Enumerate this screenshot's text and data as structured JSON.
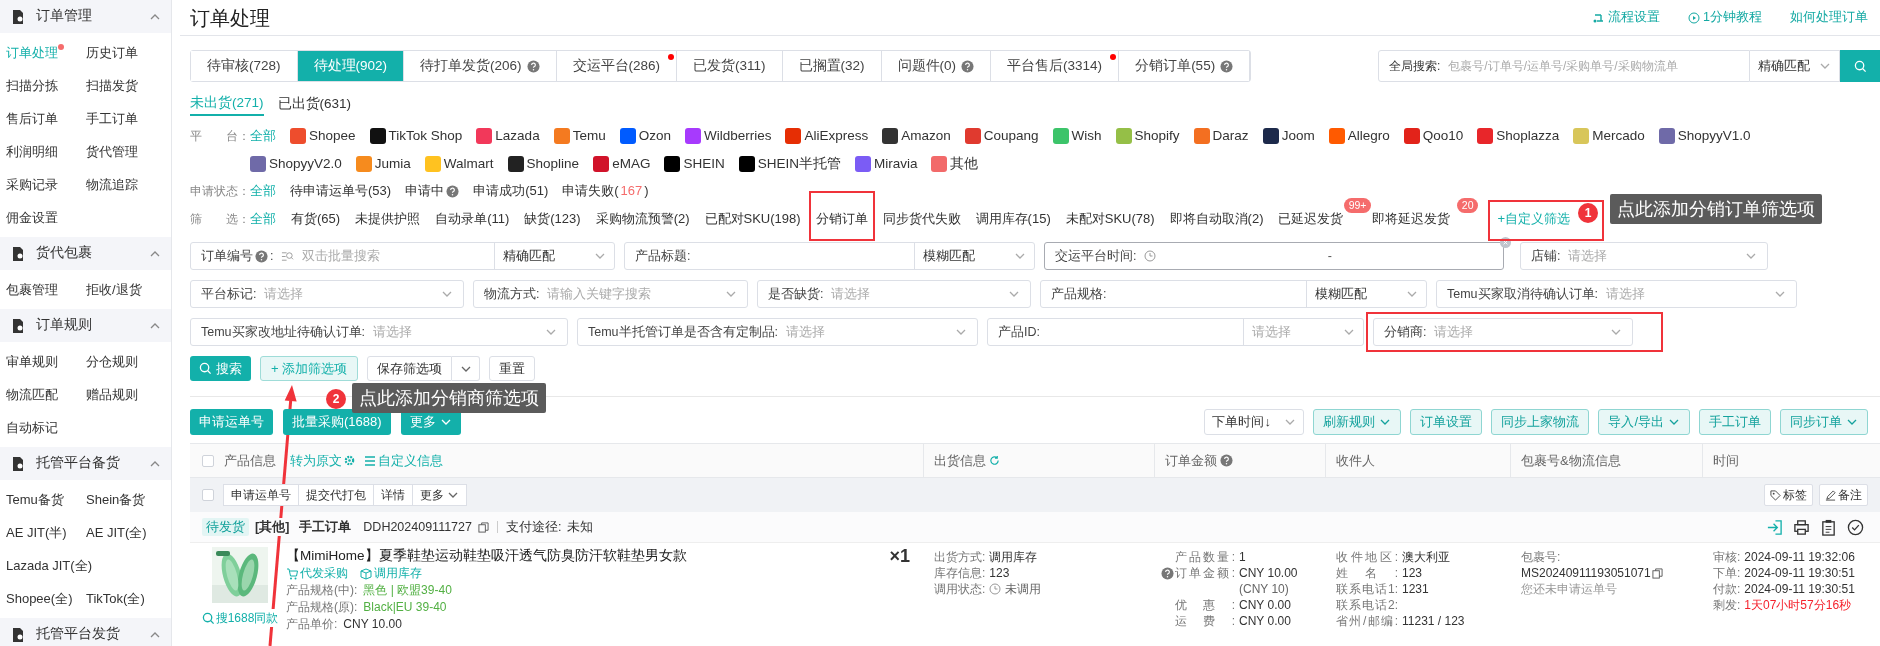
{
  "sidebar": {
    "sections": [
      {
        "title": "订单管理",
        "expanded": true,
        "items": [
          {
            "label": "订单处理",
            "selected": true,
            "dot": true
          },
          {
            "label": "历史订单",
            "selected": false,
            "dot": false
          },
          {
            "label": "扫描分拣",
            "selected": false,
            "dot": false
          },
          {
            "label": "扫描发货",
            "selected": false,
            "dot": false
          },
          {
            "label": "售后订单",
            "selected": false,
            "dot": false
          },
          {
            "label": "手工订单",
            "selected": false,
            "dot": false
          },
          {
            "label": "利润明细",
            "selected": false,
            "dot": false
          },
          {
            "label": "货代管理",
            "selected": false,
            "dot": false
          },
          {
            "label": "采购记录",
            "selected": false,
            "dot": false
          },
          {
            "label": "物流追踪",
            "selected": false,
            "dot": false
          },
          {
            "label": "佣金设置",
            "selected": false,
            "dot": false
          }
        ]
      },
      {
        "title": "货代包裹",
        "expanded": true,
        "items": [
          {
            "label": "包裹管理",
            "selected": false,
            "dot": false
          },
          {
            "label": "拒收/退货",
            "selected": false,
            "dot": false
          }
        ]
      },
      {
        "title": "订单规则",
        "expanded": true,
        "items": [
          {
            "label": "审单规则",
            "selected": false,
            "dot": false
          },
          {
            "label": "分仓规则",
            "selected": false,
            "dot": false
          },
          {
            "label": "物流匹配",
            "selected": false,
            "dot": false
          },
          {
            "label": "赠品规则",
            "selected": false,
            "dot": false
          },
          {
            "label": "自动标记",
            "selected": false,
            "dot": false
          }
        ]
      },
      {
        "title": "托管平台备货",
        "expanded": true,
        "items": [
          {
            "label": "Temu备货",
            "selected": false,
            "dot": false
          },
          {
            "label": "Shein备货",
            "selected": false,
            "dot": false
          },
          {
            "label": "AE JIT(半)",
            "selected": false,
            "dot": false
          },
          {
            "label": "AE JIT(全)",
            "selected": false,
            "dot": false
          },
          {
            "label": "Lazada JIT(全)",
            "selected": false,
            "dot": false
          },
          {
            "label": "Shopee(全)",
            "selected": false,
            "dot": false
          },
          {
            "label": "TikTok(全)",
            "selected": false,
            "dot": false
          }
        ]
      },
      {
        "title": "托管平台发货",
        "expanded": true
      }
    ]
  },
  "page_title": "订单处理",
  "header_links": [
    {
      "label": "流程设置",
      "kind": "flow"
    },
    {
      "label": "1分钟教程",
      "kind": "play"
    },
    {
      "label": "如何处理订单",
      "kind": "plain"
    }
  ],
  "status_tabs": [
    {
      "label": "待审核(728)",
      "selected": false,
      "help": false,
      "dot": false
    },
    {
      "label": "待处理(902)",
      "selected": true,
      "help": false,
      "dot": false
    },
    {
      "label": "待打单发货(206)",
      "selected": false,
      "help": true,
      "dot": false
    },
    {
      "label": "交运平台(286)",
      "selected": false,
      "help": false,
      "dot": true
    },
    {
      "label": "已发货(311)",
      "selected": false,
      "help": false,
      "dot": false
    },
    {
      "label": "已搁置(32)",
      "selected": false,
      "help": false,
      "dot": false
    },
    {
      "label": "问题件(0)",
      "selected": false,
      "help": true,
      "dot": false
    },
    {
      "label": "平台售后(3314)",
      "selected": false,
      "help": false,
      "dot": true
    },
    {
      "label": "分销订单(55)",
      "selected": false,
      "help": true,
      "dot": false
    }
  ],
  "global_search": {
    "label": "全局搜索:",
    "placeholder": "包裹号/订单号/运单号/采购单号/采购物流单",
    "match": "精确匹配"
  },
  "ship_tabs": [
    {
      "label": "未出货(271)",
      "selected": true
    },
    {
      "label": "已出货(631)",
      "selected": false
    }
  ],
  "platform_filter": {
    "label": "平　　台：",
    "all": {
      "label": "全部",
      "selected": true
    },
    "platforms": [
      {
        "label": "Shopee",
        "color": "#ee4d2d",
        "selected": false
      },
      {
        "label": "TikTok Shop",
        "color": "#111111",
        "selected": false
      },
      {
        "label": "Lazada",
        "color": "#f2385a",
        "selected": false
      },
      {
        "label": "Temu",
        "color": "#f47a20",
        "selected": false
      },
      {
        "label": "Ozon",
        "color": "#005bff",
        "selected": false
      },
      {
        "label": "Wildberries",
        "color": "#a73afd",
        "selected": false
      },
      {
        "label": "AliExpress",
        "color": "#e62e04",
        "selected": false
      },
      {
        "label": "Amazon",
        "color": "#333333",
        "selected": false
      },
      {
        "label": "Coupang",
        "color": "#e03a2f",
        "selected": false
      },
      {
        "label": "Wish",
        "color": "#3cc46a",
        "selected": false
      },
      {
        "label": "Shopify",
        "color": "#95bf47",
        "selected": false
      },
      {
        "label": "Daraz",
        "color": "#f36f21",
        "selected": false
      },
      {
        "label": "Joom",
        "color": "#1d2a4b",
        "selected": false
      },
      {
        "label": "Allegro",
        "color": "#ff5a00",
        "selected": false
      },
      {
        "label": "Qoo10",
        "color": "#e2231a",
        "selected": false
      },
      {
        "label": "Shoplazza",
        "color": "#e8262a",
        "selected": false
      },
      {
        "label": "Mercado",
        "color": "#d8c65a",
        "selected": false
      },
      {
        "label": "ShopyyV1.0",
        "color": "#6f6aa8",
        "selected": false
      },
      {
        "label": "ShopyyV2.0",
        "color": "#6f6aa8",
        "selected": false
      },
      {
        "label": "Jumia",
        "color": "#f68b1e",
        "selected": false
      },
      {
        "label": "Walmart",
        "color": "#ffc220",
        "selected": false
      },
      {
        "label": "Shopline",
        "color": "#222222",
        "selected": false
      },
      {
        "label": "eMAG",
        "color": "#d1132a",
        "selected": false
      },
      {
        "label": "SHEIN",
        "color": "#000000",
        "selected": false
      },
      {
        "label": "SHEIN半托管",
        "color": "#000000",
        "selected": false
      },
      {
        "label": "Miravia",
        "color": "#7b5cf5",
        "selected": false
      },
      {
        "label": "其他",
        "color": "#f26a6a",
        "selected": false
      }
    ]
  },
  "apply_status": {
    "label": "申请状态：",
    "options": [
      {
        "text": "全部",
        "selected": true,
        "help": false
      },
      {
        "text": "待申请运单号(53)",
        "selected": false,
        "help": false
      },
      {
        "text": "申请中",
        "selected": false,
        "help": true
      },
      {
        "text": "申请成功(51)",
        "selected": false,
        "help": false
      },
      {
        "text": "申请失败(",
        "alert": "167",
        "tail": ")",
        "selected": false,
        "help": false
      }
    ]
  },
  "quick_filter": {
    "label": "筛　　选：",
    "options": [
      {
        "text": "全部",
        "selected": true,
        "kind": "chip"
      },
      {
        "text": "有货(65)",
        "selected": false,
        "kind": "chip"
      },
      {
        "text": "未提供护照",
        "selected": false,
        "kind": "chip"
      },
      {
        "text": "自动录单(11)",
        "selected": false,
        "kind": "chip"
      },
      {
        "text": "缺货(123)",
        "selected": false,
        "kind": "chip"
      },
      {
        "text": "采购物流预警(2)",
        "selected": false,
        "kind": "chip"
      },
      {
        "text": "已配对SKU(198)",
        "selected": false,
        "kind": "chip"
      },
      {
        "text": "分销订单",
        "selected": false,
        "kind": "chip"
      },
      {
        "text": "同步货代失败",
        "selected": false,
        "kind": "chip"
      },
      {
        "text": "调用库存(15)",
        "selected": false,
        "kind": "chip"
      },
      {
        "text": "未配对SKU(78)",
        "selected": false,
        "kind": "chip"
      },
      {
        "text": "即将自动取消(2)",
        "selected": false,
        "kind": "chip"
      },
      {
        "text": "已延迟发货",
        "badge": "99+",
        "selected": false,
        "kind": "chip"
      },
      {
        "text": "即将延迟发货",
        "badge": "20",
        "selected": false,
        "kind": "chip"
      },
      {
        "text": "+自定义筛选",
        "kind": "link"
      }
    ]
  },
  "filter_rows": [
    [
      {
        "kind": "batch",
        "label": "订单编号",
        "help": true,
        "label_tail": ":",
        "placeholder": "双击批量搜索",
        "match": "精确匹配"
      },
      {
        "kind": "match",
        "label": "产品标题:",
        "match": "模糊匹配"
      },
      {
        "kind": "date",
        "label": "交运平台时间:",
        "separator": "-"
      },
      {
        "kind": "select",
        "label": "店铺:",
        "placeholder": "请选择"
      }
    ],
    [
      {
        "kind": "select",
        "label": "平台标记:",
        "placeholder": "请选择"
      },
      {
        "kind": "select",
        "label": "物流方式:",
        "placeholder": "请输入关键字搜索"
      },
      {
        "kind": "select",
        "label": "是否缺货:",
        "placeholder": "请选择"
      },
      {
        "kind": "match",
        "label": "产品规格:",
        "match": "模糊匹配"
      },
      {
        "kind": "select",
        "label": "Temu买家取消待确认订单:",
        "placeholder": "请选择"
      }
    ],
    [
      {
        "kind": "select",
        "label": "Temu买家改地址待确认订单:",
        "placeholder": "请选择"
      },
      {
        "kind": "select",
        "label": "Temu半托管订单是否含有定制品:",
        "placeholder": "请选择"
      },
      {
        "kind": "split",
        "label": "产品ID:",
        "placeholder": "请选择"
      },
      {
        "kind": "select",
        "label": "分销商:",
        "placeholder": "请选择"
      }
    ]
  ],
  "filter_actions": [
    {
      "label": "搜索",
      "kind": "primary"
    },
    {
      "label": "+ 添加筛选项",
      "kind": "outline"
    },
    {
      "label": "保存筛选项",
      "kind": "split"
    },
    {
      "label": "重置",
      "kind": "plain"
    }
  ],
  "toolbar_left": [
    {
      "label": "申请运单号",
      "caret": false
    },
    {
      "label": "批量采购(1688)",
      "caret": false
    },
    {
      "label": "更多",
      "caret": true
    }
  ],
  "sort": {
    "value": "下单时间↓"
  },
  "toolbar_right": [
    {
      "label": "刷新规则",
      "caret": true
    },
    {
      "label": "订单设置",
      "caret": false
    },
    {
      "label": "同步上家物流",
      "caret": false
    },
    {
      "label": "导入/导出",
      "caret": true
    },
    {
      "label": "手工订单",
      "caret": false
    },
    {
      "label": "同步订单",
      "caret": true
    }
  ],
  "table": {
    "all_checked": false,
    "product_header": {
      "title": "产品信息",
      "translate": "转为原文",
      "custom": "自定义信息"
    },
    "columns": [
      {
        "label": "出货信息"
      },
      {
        "label": "订单金额"
      },
      {
        "label": "收件人"
      },
      {
        "label": "包裹号&物流信息"
      },
      {
        "label": "时间"
      }
    ],
    "batch_actions": [
      {
        "label": "申请运单号",
        "caret": false
      },
      {
        "label": "提交代打包",
        "caret": false
      },
      {
        "label": "详情",
        "caret": false
      },
      {
        "label": "更多",
        "caret": true
      }
    ],
    "right_actions": [
      {
        "label": "标签",
        "kind": "tag"
      },
      {
        "label": "备注",
        "kind": "edit"
      }
    ],
    "order": {
      "checked": false,
      "status": "待发货",
      "platform": "[其他]",
      "type": "手工订单",
      "order_no": "DDH202409111727",
      "payment_label": "支付途径:",
      "payment": "未知",
      "product": {
        "title": "【MimiHome】夏季鞋垫运动鞋垫吸汗透气防臭防汗软鞋垫男女款",
        "quantity": "×1",
        "search_link": "搜1688同款",
        "purchase": "代发采购",
        "stock": "调用库存",
        "specs": [
          {
            "label": "产品规格(中):",
            "value": "黑色 | 欧盟39-40",
            "kind": "spec"
          },
          {
            "label": "产品规格(原):",
            "value": "Black|EU 39-40",
            "kind": "spec"
          },
          {
            "label": "产品单价:",
            "value": "CNY 10.00",
            "kind": "price"
          }
        ]
      },
      "shipping": [
        {
          "label": "出货方式:",
          "value": "调用库存",
          "kind": "plain"
        },
        {
          "label": "库存信息:",
          "value": "123",
          "kind": "plain"
        },
        {
          "label": "调用状态:",
          "value": "未调用",
          "kind": "clock"
        }
      ],
      "amounts": [
        {
          "label": "产品数量:",
          "value": "1",
          "help": false
        },
        {
          "label": "订单金额:",
          "value": "CNY 10.00",
          "help": true
        },
        {
          "value": "(CNY 10)",
          "help": false
        },
        {
          "label": "优惠:",
          "value": "CNY 0.00",
          "help": false
        },
        {
          "label": "运费:",
          "value": "CNY 0.00",
          "help": false
        }
      ],
      "recipient": [
        {
          "label": "收件地区:",
          "value": "澳大利亚"
        },
        {
          "label": "姓名:",
          "value": "123"
        },
        {
          "label": "联系电话1:",
          "value": "1231"
        },
        {
          "label": "联系电话2:"
        },
        {
          "label": "省州/邮编:",
          "value": "11231 / 123"
        }
      ],
      "package": {
        "label": "包裹号:",
        "number": "MS20240911193051071",
        "note": "您还未申请运单号"
      },
      "times": [
        {
          "label": "审核:",
          "value": "2024-09-11 19:32:06",
          "alert": false
        },
        {
          "label": "下单:",
          "value": "2024-09-11 19:30:51",
          "alert": false
        },
        {
          "label": "付款:",
          "value": "2024-09-11 19:30:51",
          "alert": false
        },
        {
          "label": "剩发:",
          "value": "1天07小时57分16秒",
          "alert": true
        }
      ]
    }
  },
  "annotations": [
    {
      "number": "1",
      "text": "点此添加分销订单筛选项"
    },
    {
      "number": "2",
      "text": "点此添加分销商筛选项"
    }
  ]
}
